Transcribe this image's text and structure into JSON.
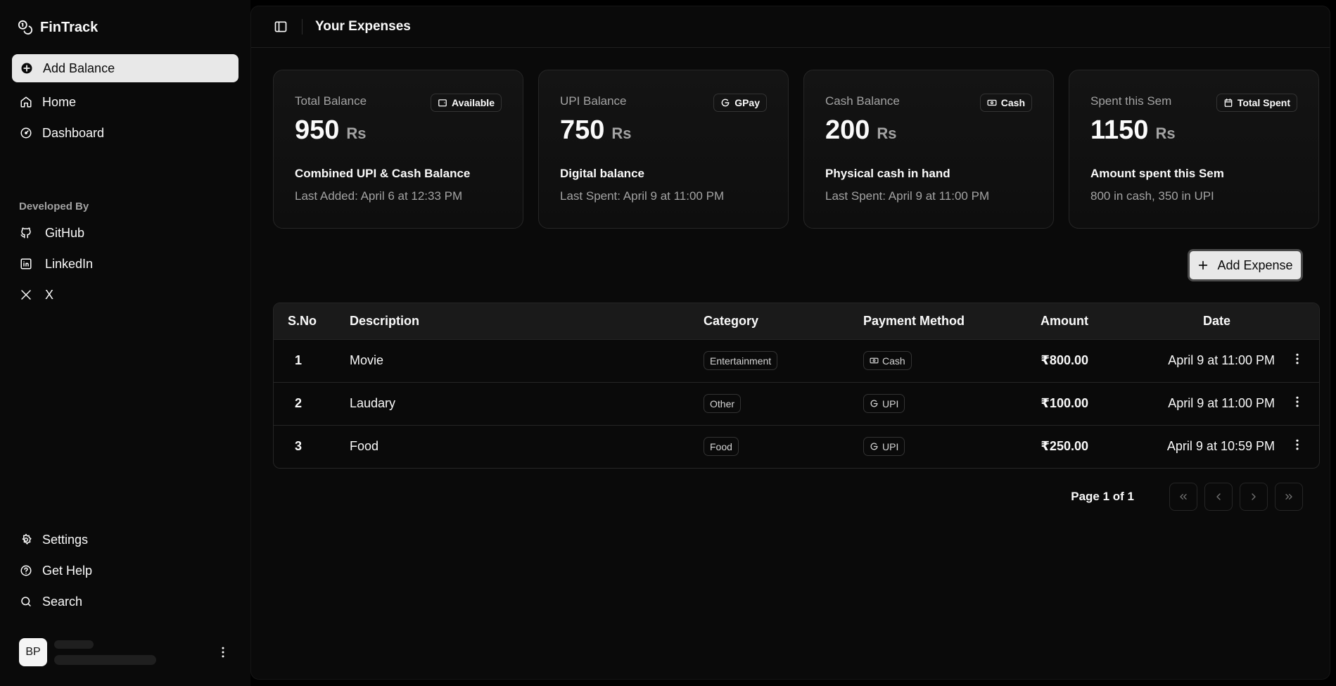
{
  "app": {
    "name": "FinTrack"
  },
  "sidebar": {
    "add_balance_label": "Add Balance",
    "nav": [
      {
        "label": "Home",
        "icon": "home-icon"
      },
      {
        "label": "Dashboard",
        "icon": "gauge-icon"
      }
    ],
    "developed_by_label": "Developed By",
    "socials": [
      {
        "label": "GitHub",
        "icon": "github-icon"
      },
      {
        "label": "LinkedIn",
        "icon": "linkedin-icon"
      },
      {
        "label": "X",
        "icon": "x-icon"
      }
    ],
    "bottom": [
      {
        "label": "Settings",
        "icon": "gear-icon"
      },
      {
        "label": "Get Help",
        "icon": "help-icon"
      },
      {
        "label": "Search",
        "icon": "search-icon"
      }
    ],
    "user": {
      "initials": "BP"
    }
  },
  "header": {
    "title": "Your Expenses"
  },
  "cards": [
    {
      "label": "Total Balance",
      "badge": "Available",
      "badge_icon": "wallet-icon",
      "value": "950",
      "unit": "Rs",
      "subtitle": "Combined UPI & Cash Balance",
      "note": "Last Added: April 6 at 12:33 PM"
    },
    {
      "label": "UPI Balance",
      "badge": "GPay",
      "badge_icon": "google-icon",
      "value": "750",
      "unit": "Rs",
      "subtitle": "Digital balance",
      "note": "Last Spent: April 9 at 11:00 PM"
    },
    {
      "label": "Cash Balance",
      "badge": "Cash",
      "badge_icon": "banknote-icon",
      "value": "200",
      "unit": "Rs",
      "subtitle": "Physical cash in hand",
      "note": "Last Spent: April 9 at 11:00 PM"
    },
    {
      "label": "Spent this Sem",
      "badge": "Total Spent",
      "badge_icon": "calendar-icon",
      "value": "1150",
      "unit": "Rs",
      "subtitle": "Amount spent this Sem",
      "note": "800 in cash, 350 in UPI"
    }
  ],
  "add_expense_label": "Add Expense",
  "table": {
    "columns": [
      "S.No",
      "Description",
      "Category",
      "Payment Method",
      "Amount",
      "Date"
    ],
    "rows": [
      {
        "sno": "1",
        "description": "Movie",
        "category": "Entertainment",
        "payment": "Cash",
        "payment_icon": "banknote-icon",
        "amount": "₹800.00",
        "date": "April 9 at 11:00 PM"
      },
      {
        "sno": "2",
        "description": "Laudary",
        "category": "Other",
        "payment": "UPI",
        "payment_icon": "google-icon",
        "amount": "₹100.00",
        "date": "April 9 at 11:00 PM"
      },
      {
        "sno": "3",
        "description": "Food",
        "category": "Food",
        "payment": "UPI",
        "payment_icon": "google-icon",
        "amount": "₹250.00",
        "date": "April 9 at 10:59 PM"
      }
    ]
  },
  "pagination": {
    "text": "Page 1 of 1"
  },
  "colors": {
    "background": "#000000",
    "panel": "#0a0a0a",
    "accent": "#e8e8e8",
    "muted": "#a3a3a3"
  }
}
